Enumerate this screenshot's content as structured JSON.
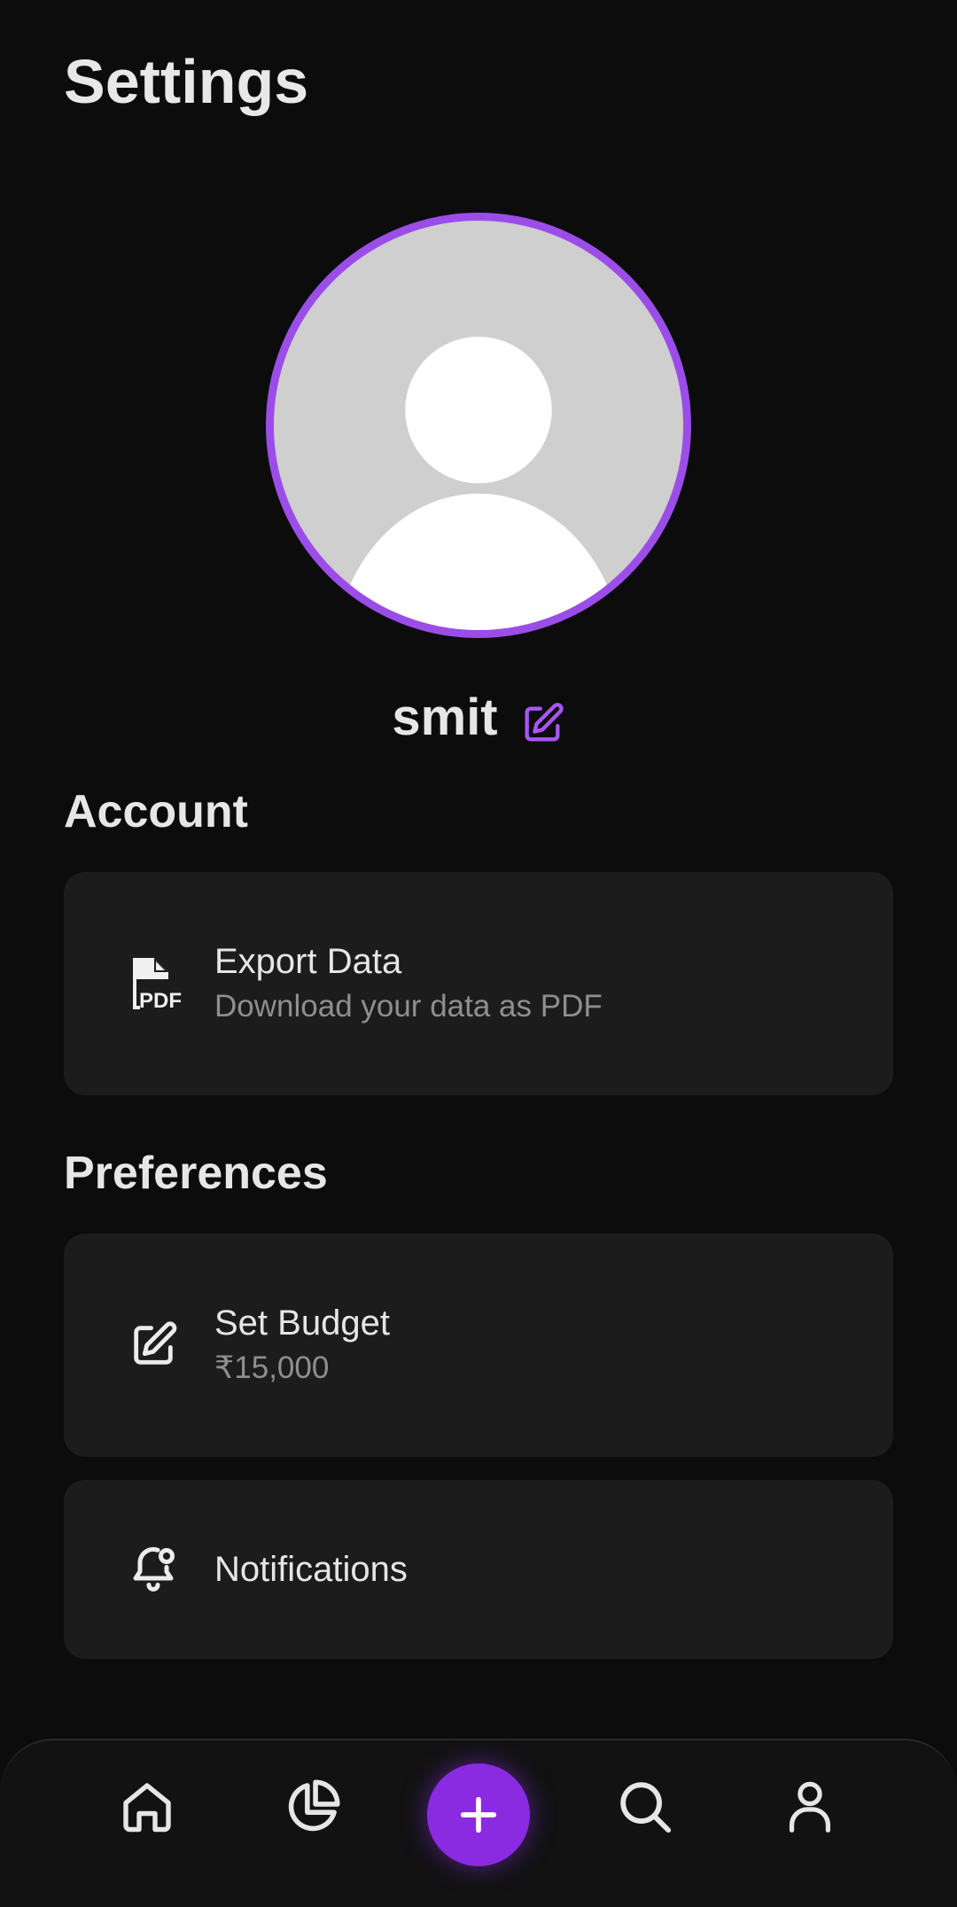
{
  "page": {
    "title": "Settings"
  },
  "profile": {
    "name": "smit",
    "edit_icon": "edit-square-icon",
    "avatar_icon": "person-silhouette-icon"
  },
  "sections": {
    "account": {
      "title": "Account",
      "items": [
        {
          "title": "Export Data",
          "subtitle": "Download your data as PDF",
          "icon": "pdf-file-icon"
        }
      ]
    },
    "preferences": {
      "title": "Preferences",
      "items": [
        {
          "title": "Set Budget",
          "subtitle": "₹15,000",
          "icon": "edit-square-icon"
        },
        {
          "title": "Notifications",
          "icon": "bell-icon"
        }
      ]
    }
  },
  "bottom_nav": {
    "items": [
      "home-icon",
      "pie-chart-icon",
      "plus-icon",
      "search-icon",
      "user-icon"
    ]
  },
  "colors": {
    "background": "#0c0c0d",
    "card": "#1c1c1d",
    "accent": "#8a2be2",
    "avatar_ring": "#9b4de8",
    "text_primary": "#e6e6e6",
    "text_secondary": "#8f8f8f"
  }
}
